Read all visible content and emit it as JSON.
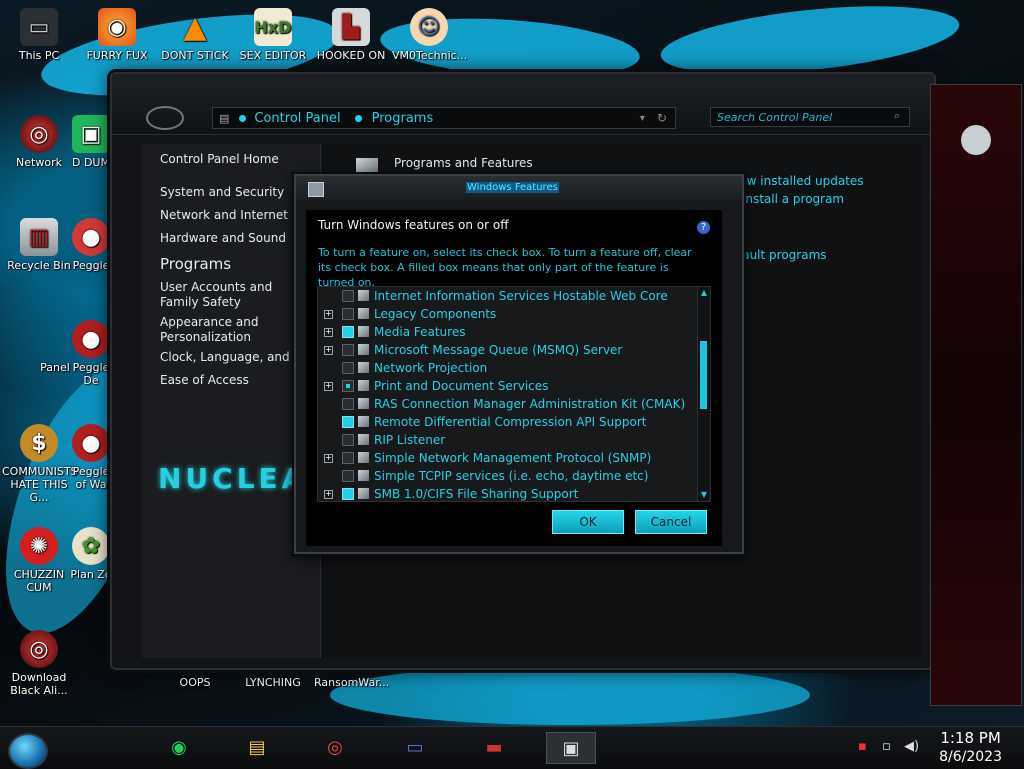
{
  "desktop": {
    "icons": [
      {
        "label": "This PC"
      },
      {
        "label": "FURRY FUX"
      },
      {
        "label": "DONT STICK"
      },
      {
        "label": "SEX EDITOR"
      },
      {
        "label": "HOOKED ON"
      },
      {
        "label": "VM0Technic..."
      },
      {
        "label": "Network"
      },
      {
        "label": "D DUM"
      },
      {
        "label": "Recycle Bin"
      },
      {
        "label": "Peggle"
      },
      {
        "label": "Panel"
      },
      {
        "label": "Peggle De"
      },
      {
        "label": "COMMUNISTS HATE THIS G..."
      },
      {
        "label": "Peggle of Wa"
      },
      {
        "label": "CHUZZIN CUM"
      },
      {
        "label": "Plan Zo"
      },
      {
        "label": "Download Black Ali..."
      },
      {
        "label": "OOPS"
      },
      {
        "label": "LYNCHING"
      },
      {
        "label": "RansomWar..."
      }
    ]
  },
  "control_panel": {
    "address": {
      "root": "Control Panel",
      "current": "Programs"
    },
    "search_placeholder": "Search Control Panel",
    "sidebar": {
      "home": "Control Panel Home",
      "items": [
        "System and Security",
        "Network and Internet",
        "Hardware and Sound"
      ],
      "current": "Programs",
      "items2": [
        "User Accounts and Family Safety",
        "Appearance and Personalization",
        "Clock, Language, and Region",
        "Ease of Access"
      ],
      "banner": "NUCLEAI"
    },
    "main": {
      "section_title": "Programs and Features",
      "links": [
        "View installed updates",
        "install a program",
        "fault programs"
      ]
    }
  },
  "dialog": {
    "title": "Windows Features",
    "heading": "Turn Windows features on or off",
    "help": "?",
    "description": "To turn a feature on, select its check box. To turn a feature off, clear its check box. A filled box means that only part of the feature is turned on.",
    "features": [
      {
        "label": "Internet Information Services Hostable Web Core",
        "expandable": false,
        "state": "off"
      },
      {
        "label": "Legacy Components",
        "expandable": true,
        "state": "off"
      },
      {
        "label": "Media Features",
        "expandable": true,
        "state": "on"
      },
      {
        "label": "Microsoft Message Queue (MSMQ) Server",
        "expandable": true,
        "state": "off"
      },
      {
        "label": "Network Projection",
        "expandable": false,
        "state": "off"
      },
      {
        "label": "Print and Document Services",
        "expandable": true,
        "state": "partial"
      },
      {
        "label": "RAS Connection Manager Administration Kit (CMAK)",
        "expandable": false,
        "state": "off"
      },
      {
        "label": "Remote Differential Compression API Support",
        "expandable": false,
        "state": "on"
      },
      {
        "label": "RIP Listener",
        "expandable": false,
        "state": "off"
      },
      {
        "label": "Simple Network Management Protocol (SNMP)",
        "expandable": true,
        "state": "off"
      },
      {
        "label": "Simple TCPIP services (i.e. echo, daytime etc)",
        "expandable": false,
        "state": "off"
      },
      {
        "label": "SMB 1.0/CIFS File Sharing Support",
        "expandable": true,
        "state": "on"
      }
    ],
    "ok_label": "OK",
    "cancel_label": "Cancel"
  },
  "taskbar": {
    "time": "1:18 PM",
    "date": "8/6/2023"
  }
}
